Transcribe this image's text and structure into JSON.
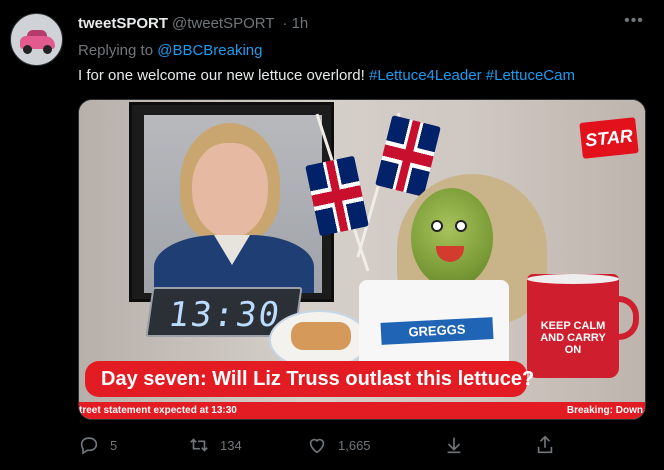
{
  "author": {
    "name": "tweetSPORT",
    "handle": "@tweetSPORT",
    "time": "· 1h"
  },
  "reply": {
    "prefix": "Replying to ",
    "to": "@BBCBreaking"
  },
  "text": {
    "main": "I for one welcome our new lettuce overlord! ",
    "tag1": "#Lettuce4Leader",
    "tag2": "#LettuceCam"
  },
  "media": {
    "clock": "13:30",
    "bag_brand": "GREGGS",
    "logo": "STAR",
    "mug_text": "KEEP CALM AND CARRY ON",
    "headline": "Day seven: Will Liz Truss outlast this lettuce?",
    "ticker_left": "treet statement expected at 13:30",
    "ticker_right": "Breaking: Down"
  },
  "actions": {
    "reply_count": "5",
    "retweet_count": "134",
    "like_count": "1,665"
  },
  "colors": {
    "accent": "#1d9bf0",
    "muted": "#71767b",
    "background": "#000000",
    "breaking_red": "#e31b23"
  }
}
